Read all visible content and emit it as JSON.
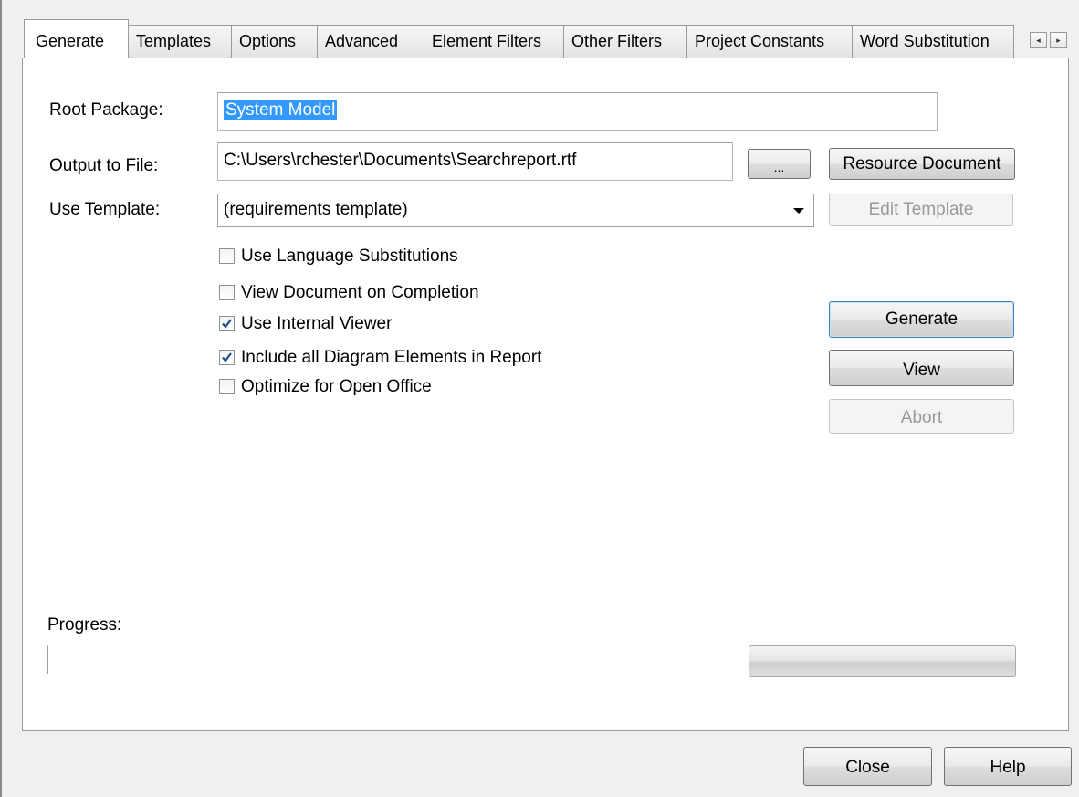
{
  "tabs": [
    {
      "label": "Generate",
      "active": true
    },
    {
      "label": "Templates"
    },
    {
      "label": "Options"
    },
    {
      "label": "Advanced"
    },
    {
      "label": "Element Filters"
    },
    {
      "label": "Other Filters"
    },
    {
      "label": "Project Constants"
    },
    {
      "label": "Word Substitution"
    }
  ],
  "tab_scroll": {
    "left": "◂",
    "right": "▸"
  },
  "form": {
    "root_package_label": "Root Package:",
    "root_package_value": "System Model",
    "output_label": "Output to File:",
    "output_value": "C:\\Users\\rchester\\Documents\\Searchreport.rtf",
    "browse_label": "...",
    "resource_document_label": "Resource Document",
    "template_label": "Use Template:",
    "template_value": "(requirements template)",
    "edit_template_label": "Edit Template"
  },
  "options": [
    {
      "label": "Use Language Substitutions",
      "checked": false
    },
    {
      "label": "View Document on Completion",
      "checked": false
    },
    {
      "label": "Use Internal Viewer",
      "checked": true
    },
    {
      "label": "Include all Diagram Elements in Report",
      "checked": true
    },
    {
      "label": "Optimize for Open Office",
      "checked": false
    }
  ],
  "actions": {
    "generate_label": "Generate",
    "view_label": "View",
    "abort_label": "Abort"
  },
  "progress": {
    "label": "Progress:",
    "value": 0
  },
  "footer": {
    "close_label": "Close",
    "help_label": "Help"
  },
  "colors": {
    "selection": "#3399ff",
    "check": "#1c4f8d",
    "default_border": "#3c7fb1"
  }
}
